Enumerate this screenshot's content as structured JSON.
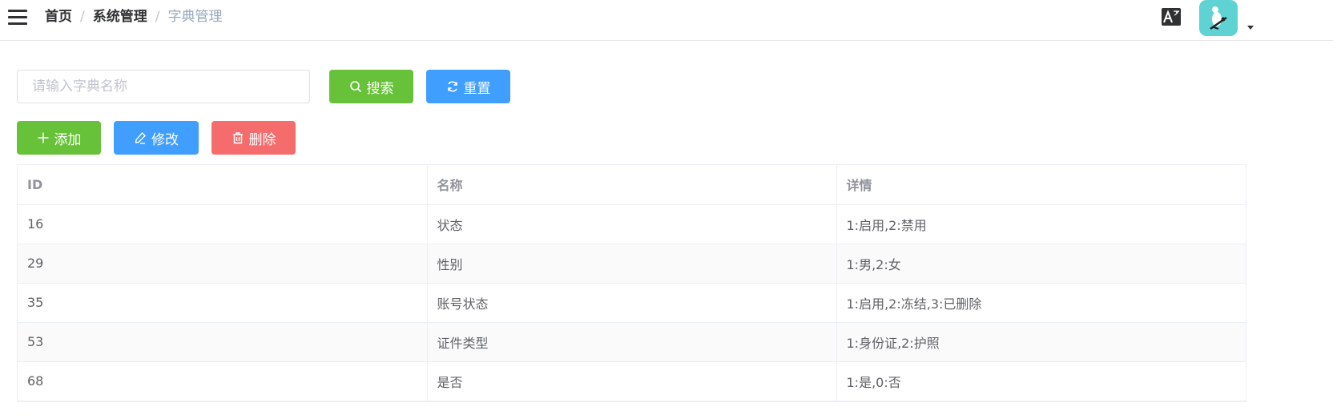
{
  "breadcrumb": {
    "home": "首页",
    "sep": "/",
    "system": "系统管理",
    "current": "字典管理"
  },
  "header": {
    "icons": [
      "hamburger-icon",
      "translate-icon",
      "avatar",
      "caret-down-icon"
    ]
  },
  "search": {
    "placeholder": "请输入字典名称",
    "value": ""
  },
  "buttons": {
    "search": "搜索",
    "reset": "重置",
    "add": "添加",
    "edit": "修改",
    "delete": "删除"
  },
  "colors": {
    "success": "#67c23a",
    "primary": "#409eff",
    "danger": "#f56c6c",
    "avatar_bg": "#5fd3d3"
  },
  "table": {
    "columns": [
      "ID",
      "名称",
      "详情"
    ],
    "rows": [
      [
        "16",
        "状态",
        "1:启用,2:禁用"
      ],
      [
        "29",
        "性别",
        "1:男,2:女"
      ],
      [
        "35",
        "账号状态",
        "1:启用,2:冻结,3:已删除"
      ],
      [
        "53",
        "证件类型",
        "1:身份证,2:护照"
      ],
      [
        "68",
        "是否",
        "1:是,0:否"
      ]
    ]
  }
}
